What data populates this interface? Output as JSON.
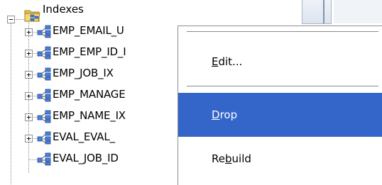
{
  "tree": {
    "folder": {
      "label": "Indexes",
      "expanded_symbol": "−"
    },
    "expand_symbol": "+",
    "items": [
      {
        "label": "EMP_EMAIL_U"
      },
      {
        "label": "EMP_EMP_ID_I"
      },
      {
        "label": "EMP_JOB_IX"
      },
      {
        "label": "EMP_MANAGE"
      },
      {
        "label": "EMP_NAME_IX"
      },
      {
        "label": "EVAL_EVAL_"
      },
      {
        "label": "EVAL_JOB_ID"
      }
    ]
  },
  "context_menu": {
    "items": [
      {
        "pre": "",
        "mnemonic": "E",
        "post": "dit..."
      },
      {
        "pre": "",
        "mnemonic": "D",
        "post": "rop"
      },
      {
        "pre": "Re",
        "mnemonic": "b",
        "post": "uild"
      }
    ],
    "highlighted_index": 1,
    "highlight_color": "#3465c9"
  },
  "icons": {
    "folder": "folder-index-icon",
    "index": "index-icon"
  }
}
